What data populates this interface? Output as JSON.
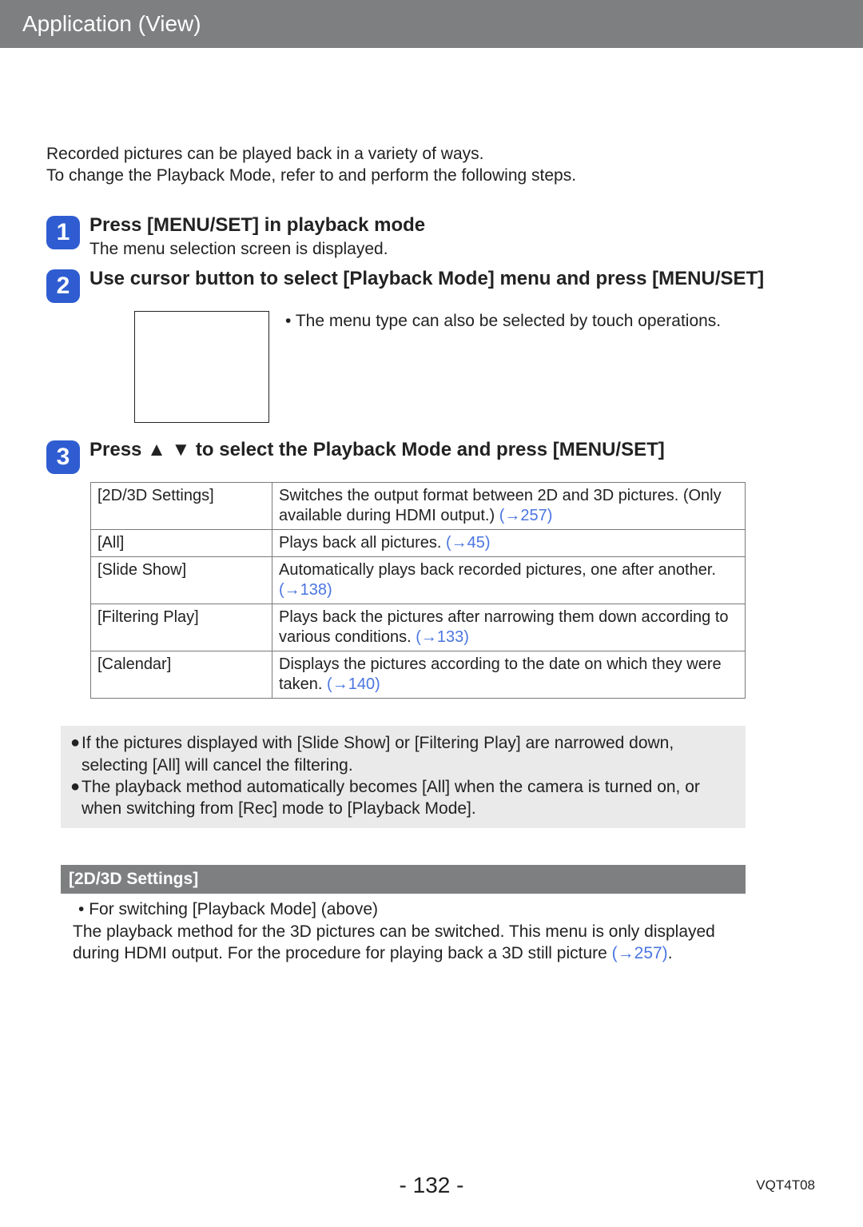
{
  "header": {
    "title": "Application (View)"
  },
  "intro": {
    "line1": "Recorded pictures can be played back in a variety of ways.",
    "line2": "To change the Playback Mode, refer to and perform the following steps."
  },
  "steps": [
    {
      "num": "1",
      "title": "Press [MENU/SET] in playback mode",
      "note": "The menu selection screen is displayed."
    },
    {
      "num": "2",
      "title": "Use cursor button to select [Playback Mode] menu and press [MENU/SET]",
      "detail_bullet": "•",
      "detail": " The menu type can also be selected by touch operations."
    },
    {
      "num": "3",
      "title_prefix": "Press ",
      "title_suffix": " to select the Playback Mode and press [MENU/SET]"
    }
  ],
  "mode_table": [
    {
      "name": "[2D/3D Settings]",
      "desc": "Switches the output format between 2D and 3D pictures. (Only available during HDMI output.) ",
      "link": "(→257)"
    },
    {
      "name": "[All]",
      "desc": "Plays back all pictures. ",
      "link": "(→45)"
    },
    {
      "name": "[Slide Show]",
      "desc": "Automatically plays back recorded pictures, one after another. ",
      "link": "(→138)"
    },
    {
      "name": "[Filtering Play]",
      "desc": "Plays back the pictures after narrowing them down according to various conditions. ",
      "link": "(→133)"
    },
    {
      "name": "[Calendar]",
      "desc": "Displays the pictures according to the date on which they were taken. ",
      "link": "(→140)"
    }
  ],
  "notes": [
    "If the pictures displayed with [Slide Show] or [Filtering Play] are narrowed down, selecting [All] will cancel the filtering.",
    "The playback method automatically becomes [All] when the camera is turned on, or when switching from [Rec] mode to [Playback Mode]."
  ],
  "subsection": {
    "title": "[2D/3D Settings]",
    "line1_bullet": "•",
    "line1": " For switching [Playback Mode] (above)",
    "line2": "The playback method for the 3D pictures can be switched. This menu is only displayed during HDMI output. For the procedure for playing back a 3D still picture ",
    "line2_link": "(→257)",
    "line2_tail": "."
  },
  "footer": {
    "page": "- 132 -",
    "docid": "VQT4T08"
  },
  "glyphs": {
    "bullet_round": "●",
    "up": "▲",
    "down": "▼"
  }
}
